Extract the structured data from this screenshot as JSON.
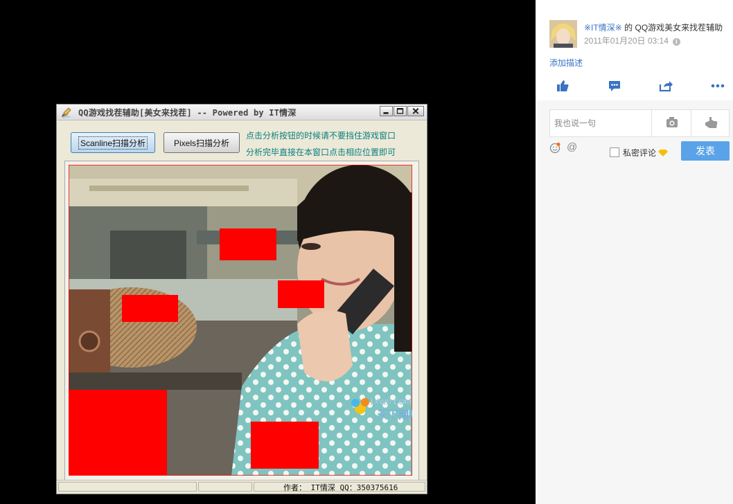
{
  "window": {
    "title": "QQ游戏找茬辅助[美女来找茬] -- Powered by IT情深",
    "buttons": {
      "scanline_label": "Scanline扫描分析",
      "pixels_label": "Pixels扫描分析"
    },
    "hints": {
      "line1": "点击分析按钮的时候请不要挡住游戏窗口",
      "line2": "分析完毕直接在本窗口点击相应位置即可"
    },
    "image_watermark": {
      "site": "TXWB.COM",
      "brand": "天下网吧"
    },
    "statusbar_text": "作者： IT情深 QQ：350375616",
    "colors": {
      "highlight": "#ff0000",
      "hint_text": "#0a7d7d"
    }
  },
  "post": {
    "author": "※IT情深※",
    "connector": "的",
    "album_title": "QQ游戏美女来找茬辅助",
    "datetime": "2011年01月20日 03:14",
    "add_description": "添加描述",
    "actions": [
      "like-icon",
      "comment-icon",
      "share-icon",
      "more-icon"
    ],
    "comment_placeholder": "我也说一句",
    "private_comment_label": "私密评论",
    "send_label": "发表",
    "colors": {
      "link": "#3a72c4",
      "send_button": "#5aa3e8"
    }
  }
}
